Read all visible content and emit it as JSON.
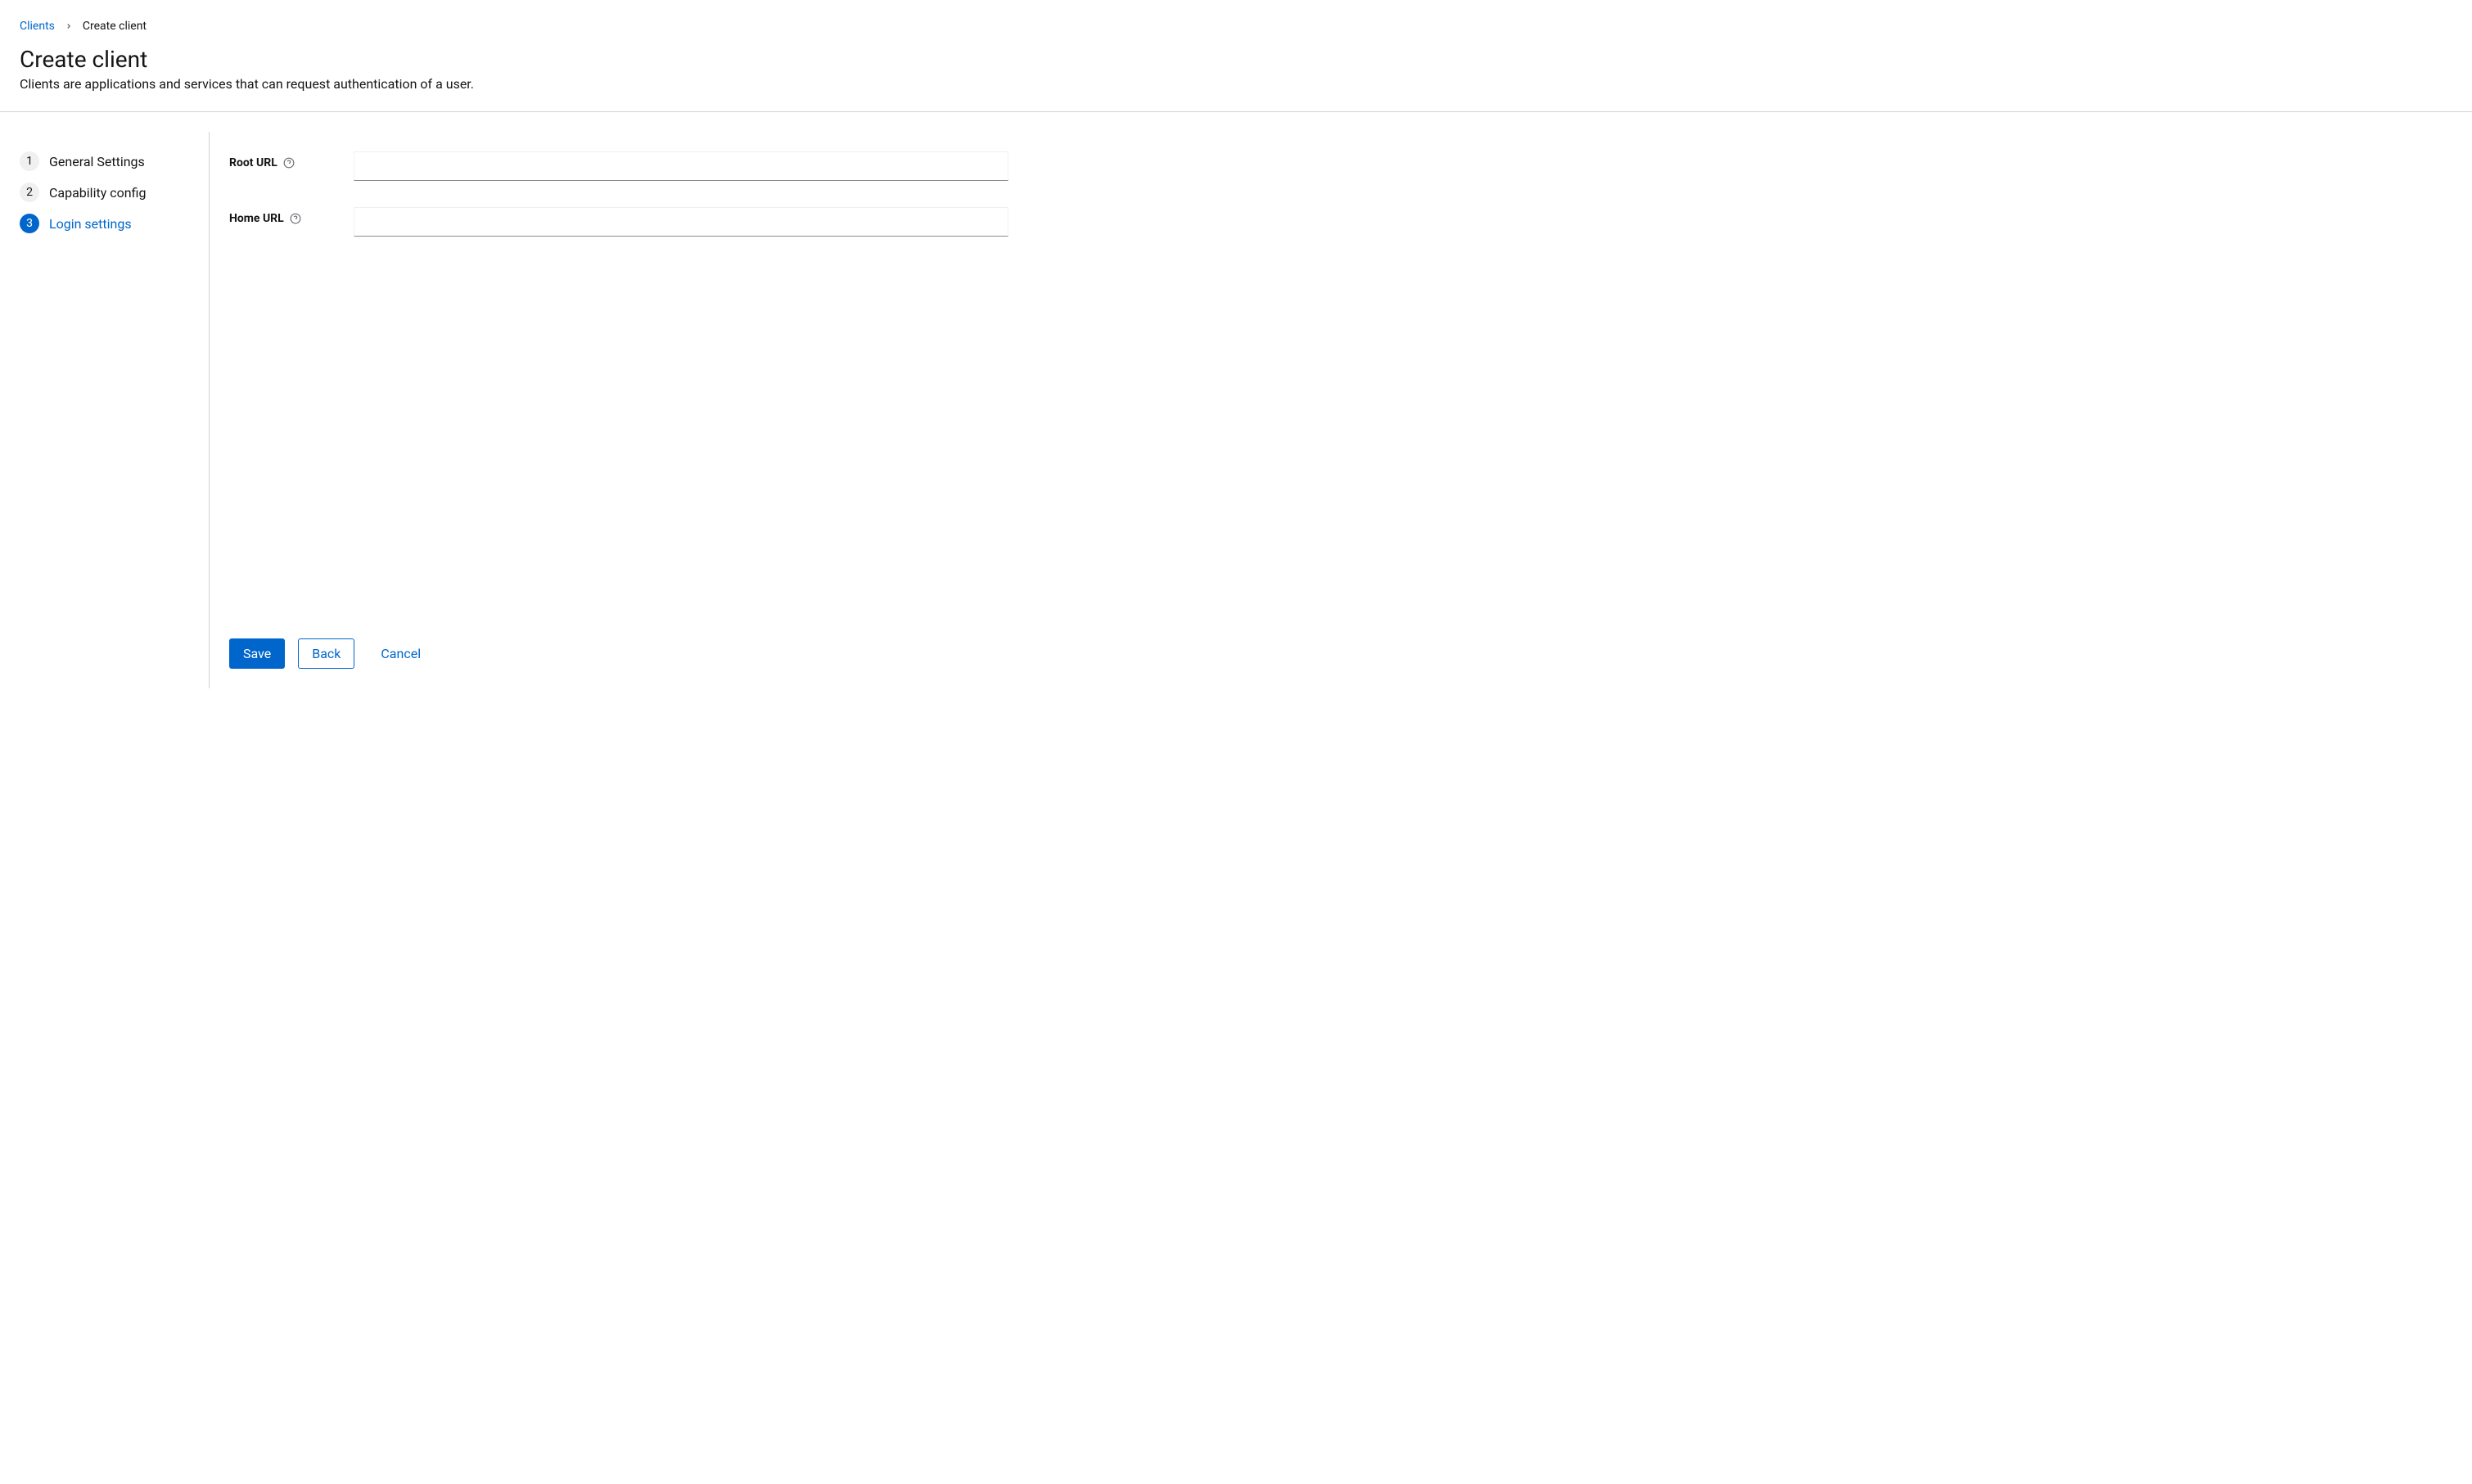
{
  "breadcrumb": {
    "link_label": "Clients",
    "current_label": "Create client"
  },
  "header": {
    "title": "Create client",
    "description": "Clients are applications and services that can request authentication of a user."
  },
  "wizard": {
    "steps": [
      {
        "number": "1",
        "label": "General Settings"
      },
      {
        "number": "2",
        "label": "Capability config"
      },
      {
        "number": "3",
        "label": "Login settings"
      }
    ],
    "active_index": 2
  },
  "form": {
    "root_url": {
      "label": "Root URL",
      "value": ""
    },
    "home_url": {
      "label": "Home URL",
      "value": ""
    }
  },
  "buttons": {
    "save": "Save",
    "back": "Back",
    "cancel": "Cancel"
  }
}
